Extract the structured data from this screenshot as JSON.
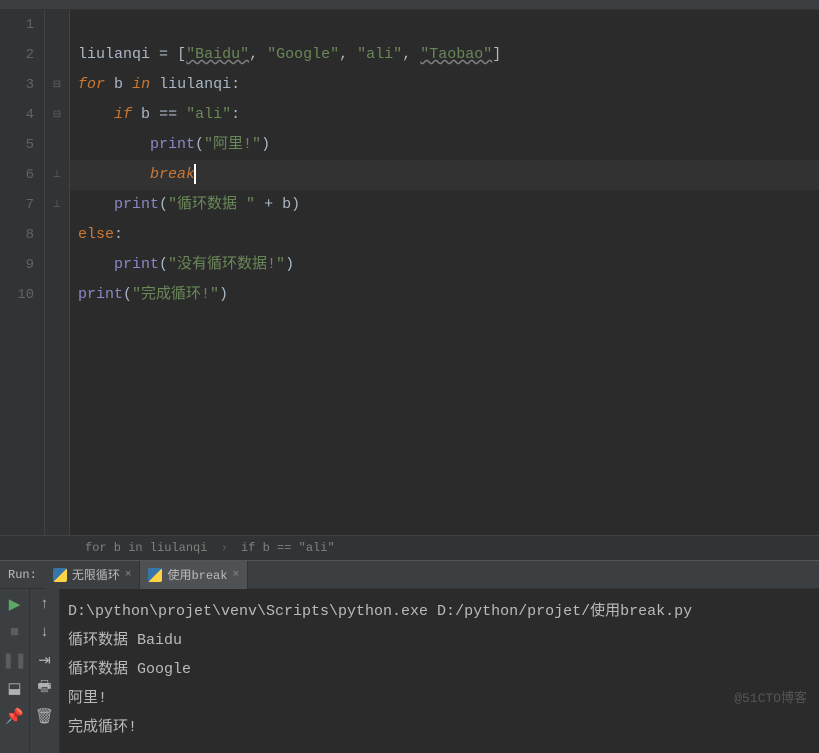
{
  "lines": [
    "1",
    "2",
    "3",
    "4",
    "5",
    "6",
    "7",
    "8",
    "9",
    "10"
  ],
  "code": {
    "l2_var": "liulanqi",
    "l2_s1": "\"Baidu\"",
    "l2_s2": "\"Google\"",
    "l2_s3": "\"ali\"",
    "l2_s4": "\"Taobao\"",
    "l3_for": "for",
    "l3_b": "b",
    "l3_in": "in",
    "l3_it": "liulanqi",
    "l4_if": "if",
    "l4_b": "b",
    "l4_eq": "==",
    "l4_s": "\"ali\"",
    "l5_print": "print",
    "l5_s": "\"阿里!\"",
    "l6_break": "break",
    "l7_print": "print",
    "l7_s": "\"循环数据 \"",
    "l7_b": "b",
    "l8_else": "else",
    "l9_print": "print",
    "l9_s": "\"没有循环数据!\"",
    "l10_print": "print",
    "l10_s": "\"完成循环!\""
  },
  "breadcrumb": {
    "p1": "for b in liulanqi",
    "p2": "if b == \"ali\""
  },
  "run": {
    "label": "Run:",
    "tab1": "无限循环",
    "tab2": "使用break"
  },
  "console": {
    "l1": "D:\\python\\projet\\venv\\Scripts\\python.exe D:/python/projet/使用break.py",
    "l2": "循环数据 Baidu",
    "l3": "循环数据 Google",
    "l4": "阿里!",
    "l5": "完成循环!"
  },
  "watermark": "@51CTO博客"
}
